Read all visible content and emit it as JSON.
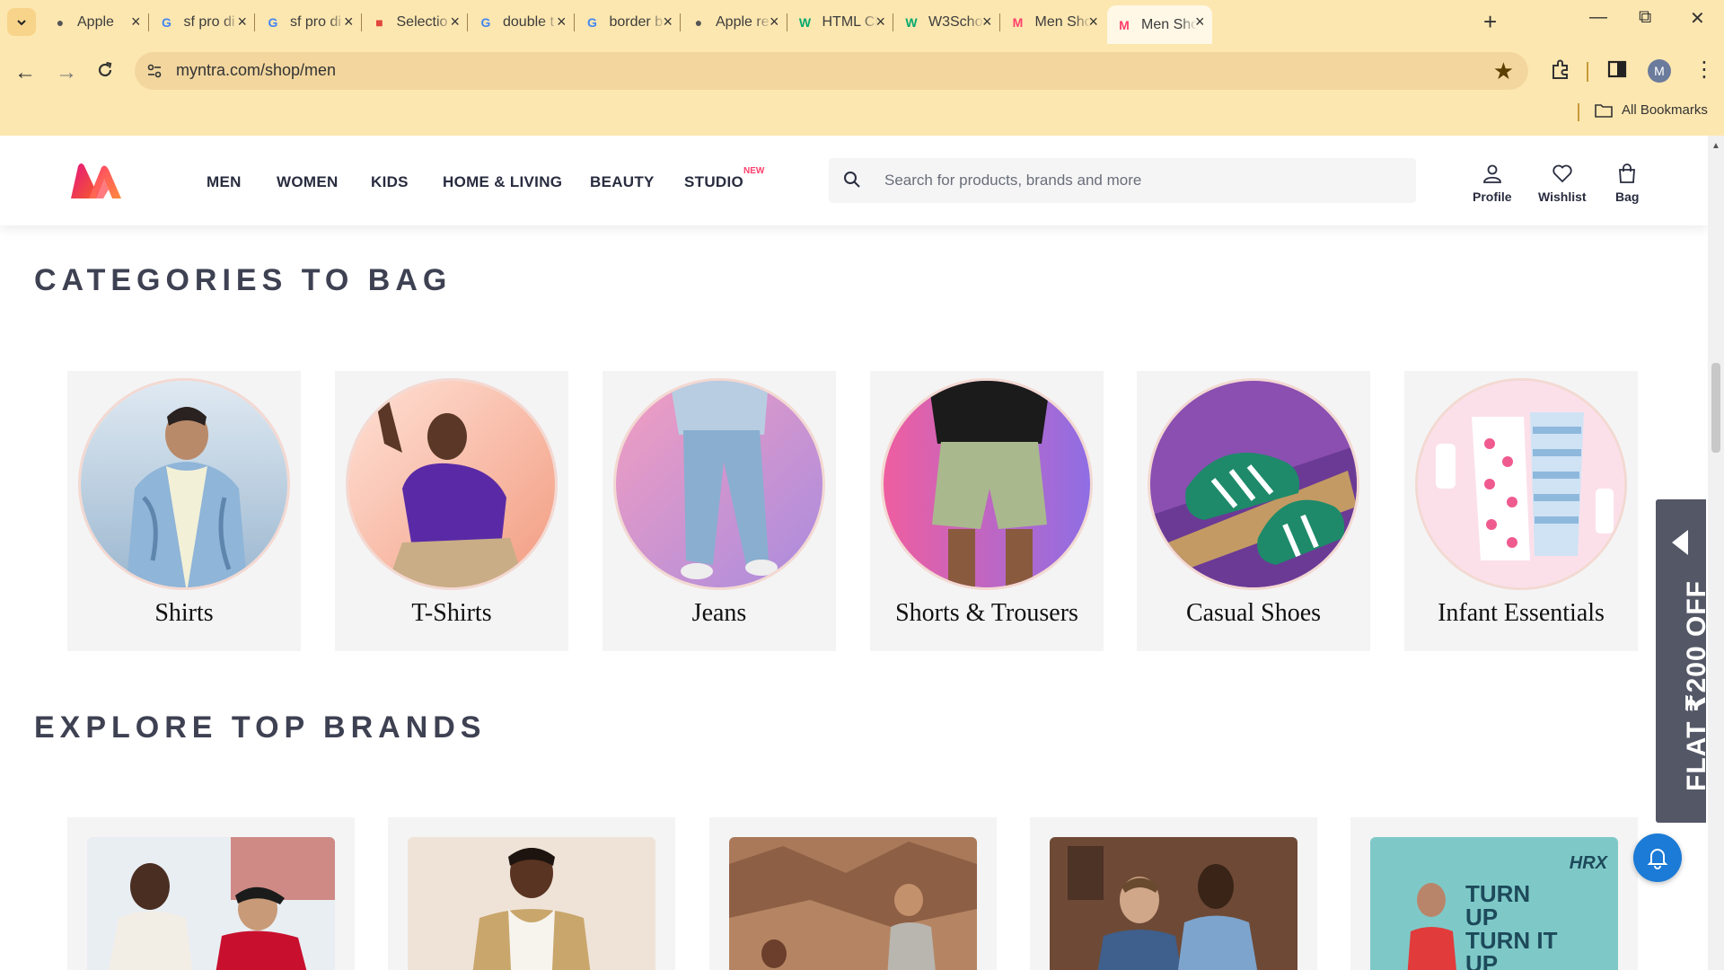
{
  "browser": {
    "tabs": [
      {
        "title": "Apple",
        "favicon": "apple-icon"
      },
      {
        "title": "sf pro di",
        "favicon": "google-icon"
      },
      {
        "title": "sf pro di",
        "favicon": "google-icon"
      },
      {
        "title": "Selectio",
        "favicon": "pinterest-icon"
      },
      {
        "title": "double t",
        "favicon": "google-icon"
      },
      {
        "title": "border b",
        "favicon": "google-icon"
      },
      {
        "title": "Apple re",
        "favicon": "apple-icon"
      },
      {
        "title": "HTML Cl",
        "favicon": "w3schools-icon"
      },
      {
        "title": "W3Scho",
        "favicon": "w3schools-icon"
      },
      {
        "title": "Men Sho",
        "favicon": "myntra-icon"
      },
      {
        "title": "Men Sho",
        "favicon": "myntra-icon",
        "active": true
      }
    ],
    "url": "myntra.com/shop/men",
    "bookmarks_label": "All Bookmarks",
    "profile_initial": "M",
    "theme_color": "#fde7b0"
  },
  "header": {
    "nav": [
      "MEN",
      "WOMEN",
      "KIDS",
      "HOME & LIVING",
      "BEAUTY",
      "STUDIO"
    ],
    "studio_badge": "NEW",
    "search_placeholder": "Search for products, brands and more",
    "actions": {
      "profile": "Profile",
      "wishlist": "Wishlist",
      "bag": "Bag"
    },
    "accent_color": "#ff3f6c"
  },
  "sections": {
    "categories_title": "CATEGORIES TO BAG",
    "brands_title": "EXPLORE TOP BRANDS"
  },
  "categories": [
    "Shirts",
    "T-Shirts",
    "Jeans",
    "Shorts & Trousers",
    "Casual Shoes",
    "Infant Essentials"
  ],
  "brands": [
    {
      "image": "nike-brand-image"
    },
    {
      "image": "brand-jacket-image"
    },
    {
      "image": "brand-outdoor-image"
    },
    {
      "image": "brand-denim-image"
    },
    {
      "image": "hrx-brand-image",
      "text": "HRX",
      "tagline": "TURN UP TURN IT UP"
    }
  ],
  "offer": {
    "text": "FLAT ₹200 OFF"
  }
}
